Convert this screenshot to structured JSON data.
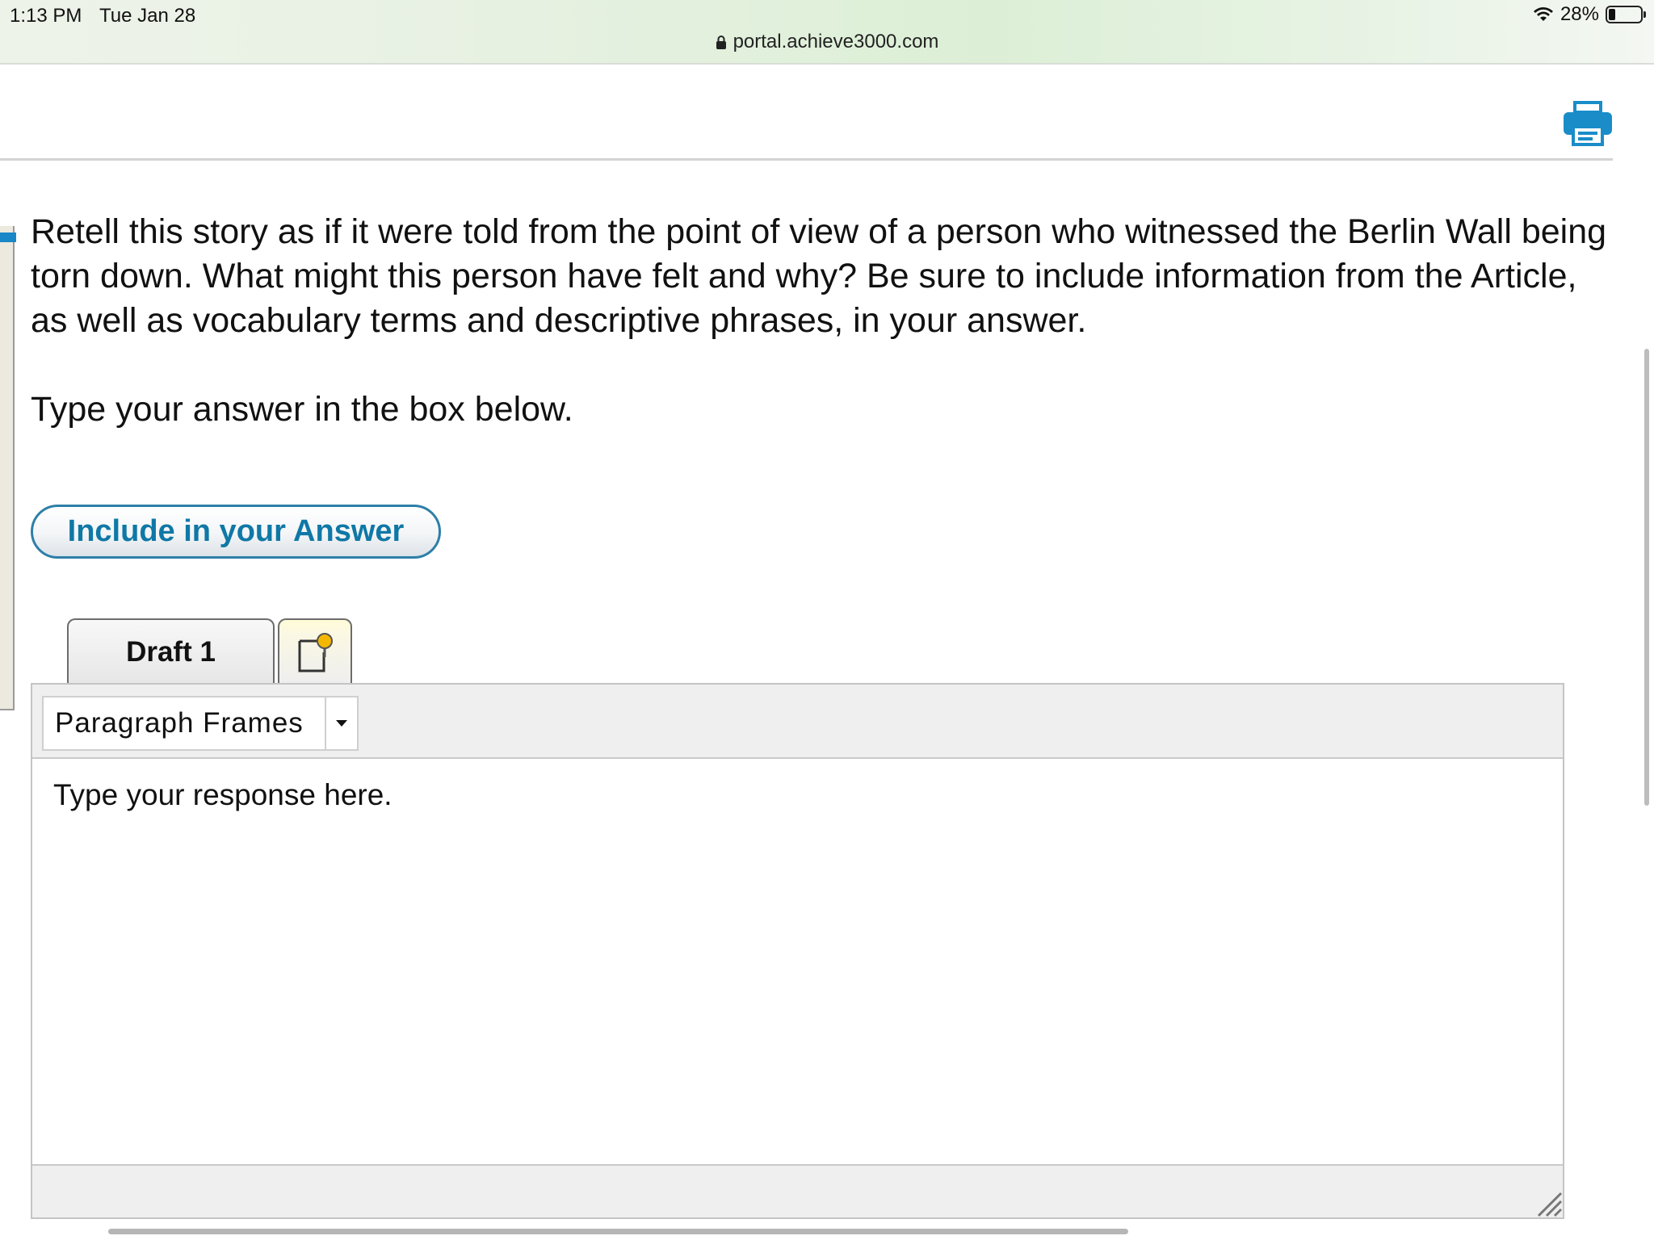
{
  "status_bar": {
    "time": "1:13 PM",
    "date": "Tue Jan 28",
    "battery": "28%",
    "url": "portal.achieve3000.com"
  },
  "header": {
    "print_icon": "printer-icon"
  },
  "question": {
    "prompt": "Retell this story as if it were told from the point of view of a person who witnessed the Berlin Wall being torn down. What might this person have felt and why? Be sure to include information from the Article, as well as vocabulary terms and descriptive phrases, in your answer.",
    "instruction": "Type your answer in the box below."
  },
  "include_button": {
    "label": "Include in your Answer"
  },
  "tabs": {
    "draft_label": "Draft 1",
    "notes_icon": "sticky-note-icon"
  },
  "editor": {
    "frames_label": "Paragraph Frames",
    "placeholder": "Type your response here."
  },
  "colors": {
    "accent": "#0f78a6",
    "print_icon": "#1a8dc9"
  }
}
